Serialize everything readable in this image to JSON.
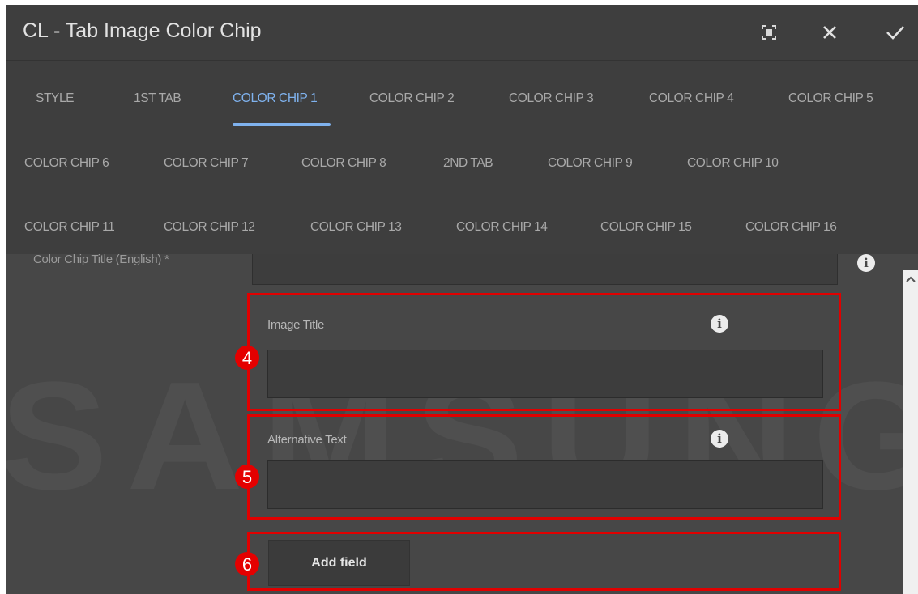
{
  "dialog": {
    "title": "CL - Tab Image Color Chip",
    "header_buttons": {
      "fullscreen_icon": "fullscreen-icon",
      "close_icon": "close-icon",
      "confirm_icon": "checkmark-icon"
    }
  },
  "tabs": {
    "active": "COLOR CHIP 1",
    "row1": [
      "STYLE",
      "1ST TAB",
      "COLOR CHIP 1",
      "COLOR CHIP 2",
      "COLOR CHIP 3",
      "COLOR CHIP 4",
      "COLOR CHIP 5"
    ],
    "row2": [
      "COLOR CHIP 6",
      "COLOR CHIP 7",
      "COLOR CHIP 8",
      "2ND TAB",
      "COLOR CHIP 9",
      "COLOR CHIP 10"
    ],
    "row3": [
      "COLOR CHIP 11",
      "COLOR CHIP 12",
      "COLOR CHIP 13",
      "COLOR CHIP 14",
      "COLOR CHIP 15",
      "COLOR CHIP 16"
    ]
  },
  "form": {
    "partial_label": "Color Chip Title (English) *",
    "image_title": {
      "label": "Image Title",
      "value": "",
      "badge": "4"
    },
    "alt_text": {
      "label": "Alternative Text",
      "value": "",
      "badge": "5"
    },
    "add_field": {
      "label": "Add field",
      "badge": "6"
    }
  },
  "watermark": "SAMSUNG",
  "colors": {
    "accent": "#7fb2ee",
    "highlight": "#e00000",
    "panel": "#474747",
    "header": "#3e3e3e"
  }
}
